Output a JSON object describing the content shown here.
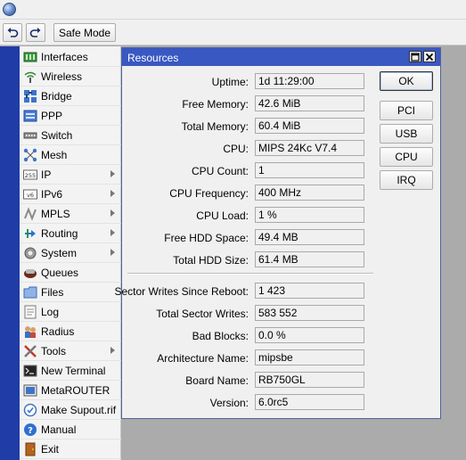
{
  "toolbar": {
    "undo_icon": "undo-icon",
    "redo_icon": "redo-icon",
    "safe_mode_label": "Safe Mode"
  },
  "sidebar": {
    "items": [
      {
        "label": "Interfaces",
        "icon": "interfaces-icon",
        "submenu": false
      },
      {
        "label": "Wireless",
        "icon": "wireless-icon",
        "submenu": false
      },
      {
        "label": "Bridge",
        "icon": "bridge-icon",
        "submenu": false
      },
      {
        "label": "PPP",
        "icon": "ppp-icon",
        "submenu": false
      },
      {
        "label": "Switch",
        "icon": "switch-icon",
        "submenu": false
      },
      {
        "label": "Mesh",
        "icon": "mesh-icon",
        "submenu": false
      },
      {
        "label": "IP",
        "icon": "ip-icon",
        "submenu": true
      },
      {
        "label": "IPv6",
        "icon": "ipv6-icon",
        "submenu": true
      },
      {
        "label": "MPLS",
        "icon": "mpls-icon",
        "submenu": true
      },
      {
        "label": "Routing",
        "icon": "routing-icon",
        "submenu": true
      },
      {
        "label": "System",
        "icon": "system-icon",
        "submenu": true
      },
      {
        "label": "Queues",
        "icon": "queues-icon",
        "submenu": false
      },
      {
        "label": "Files",
        "icon": "files-icon",
        "submenu": false
      },
      {
        "label": "Log",
        "icon": "log-icon",
        "submenu": false
      },
      {
        "label": "Radius",
        "icon": "radius-icon",
        "submenu": false
      },
      {
        "label": "Tools",
        "icon": "tools-icon",
        "submenu": true
      },
      {
        "label": "New Terminal",
        "icon": "terminal-icon",
        "submenu": false
      },
      {
        "label": "MetaROUTER",
        "icon": "metarouter-icon",
        "submenu": false
      },
      {
        "label": "Make Supout.rif",
        "icon": "supout-icon",
        "submenu": false
      },
      {
        "label": "Manual",
        "icon": "manual-icon",
        "submenu": false
      },
      {
        "label": "Exit",
        "icon": "exit-icon",
        "submenu": false
      }
    ]
  },
  "window": {
    "title": "Resources",
    "fields": [
      {
        "label": "Uptime:",
        "value": "1d 11:29:00"
      },
      {
        "label": "Free Memory:",
        "value": "42.6 MiB"
      },
      {
        "label": "Total Memory:",
        "value": "60.4 MiB"
      },
      {
        "label": "CPU:",
        "value": "MIPS 24Kc V7.4"
      },
      {
        "label": "CPU Count:",
        "value": "1"
      },
      {
        "label": "CPU Frequency:",
        "value": "400 MHz"
      },
      {
        "label": "CPU Load:",
        "value": "1 %"
      },
      {
        "label": "Free HDD Space:",
        "value": "49.4 MB"
      },
      {
        "label": "Total HDD Size:",
        "value": "61.4 MB"
      },
      {
        "label": "Sector Writes Since Reboot:",
        "value": "1 423"
      },
      {
        "label": "Total Sector Writes:",
        "value": "583 552"
      },
      {
        "label": "Bad Blocks:",
        "value": "0.0 %"
      },
      {
        "label": "Architecture Name:",
        "value": "mipsbe"
      },
      {
        "label": "Board Name:",
        "value": "RB750GL"
      },
      {
        "label": "Version:",
        "value": "6.0rc5"
      }
    ],
    "buttons": {
      "ok": "OK",
      "pci": "PCI",
      "usb": "USB",
      "cpu": "CPU",
      "irq": "IRQ"
    }
  },
  "colors": {
    "sidebar_strip": "#203ca6",
    "window_title_bar": "#3a58c2",
    "workspace": "#ababab"
  }
}
